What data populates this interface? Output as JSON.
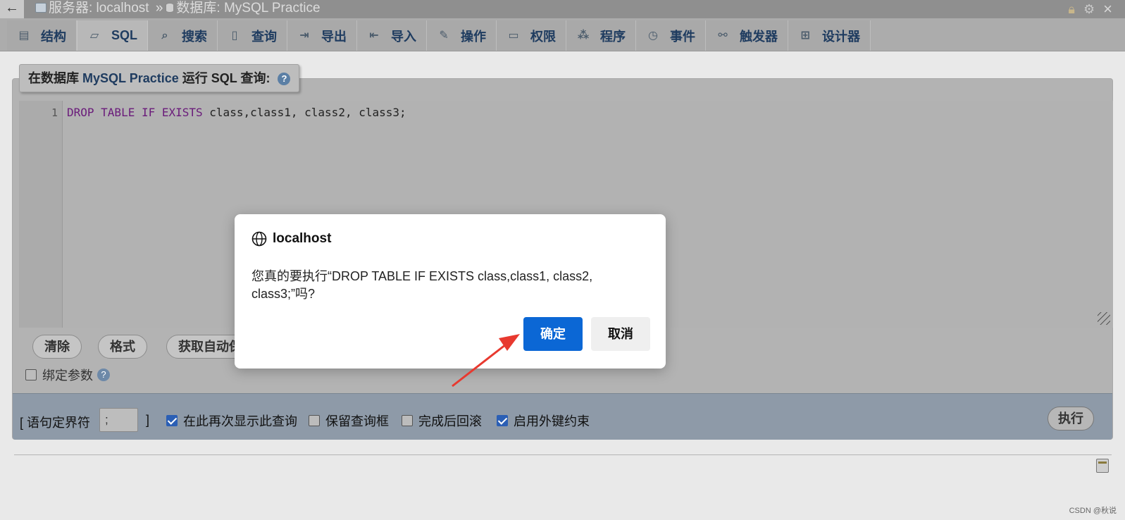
{
  "topbar": {
    "server_label": "服务器: localhost",
    "separator": "»",
    "database_label": "数据库: MySQL Practice"
  },
  "tabs": [
    {
      "label": "结构",
      "icon": "structure-icon"
    },
    {
      "label": "SQL",
      "icon": "sql-icon",
      "active": true
    },
    {
      "label": "搜索",
      "icon": "search-icon"
    },
    {
      "label": "查询",
      "icon": "query-icon"
    },
    {
      "label": "导出",
      "icon": "export-icon"
    },
    {
      "label": "导入",
      "icon": "import-icon"
    },
    {
      "label": "操作",
      "icon": "wrench-icon"
    },
    {
      "label": "权限",
      "icon": "privileges-icon"
    },
    {
      "label": "程序",
      "icon": "routines-icon"
    },
    {
      "label": "事件",
      "icon": "clock-icon"
    },
    {
      "label": "触发器",
      "icon": "triggers-icon"
    },
    {
      "label": "设计器",
      "icon": "designer-icon"
    }
  ],
  "panel": {
    "legend_prefix": "在数据库",
    "legend_db": "MySQL Practice",
    "legend_suffix": "运行 SQL 查询:",
    "help": "?"
  },
  "editor": {
    "line_number": "1",
    "code_keywords": "DROP TABLE IF EXISTS",
    "code_rest": " class,class1, class2, class3;"
  },
  "buttons": {
    "clear": "清除",
    "format": "格式",
    "autosave": "获取自动保"
  },
  "bind_params": {
    "label": "绑定参数",
    "checked": false
  },
  "options": {
    "delimiter_label": "[ 语句定界符",
    "delimiter_value": ";",
    "delimiter_close": "]",
    "show_again": {
      "label": "在此再次显示此查询",
      "checked": true
    },
    "keep_box": {
      "label": "保留查询框",
      "checked": false
    },
    "rollback": {
      "label": "完成后回滚",
      "checked": false
    },
    "foreign_keys": {
      "label": "启用外键约束",
      "checked": true
    },
    "run": "执行"
  },
  "dialog": {
    "title": "localhost",
    "message": "您真的要执行“DROP TABLE IF EXISTS class,class1, class2, class3;”吗?",
    "ok": "确定",
    "cancel": "取消"
  },
  "watermark": "CSDN @秋说",
  "colors": {
    "primary_button": "#0b67d5",
    "arrow": "#e8392f"
  }
}
